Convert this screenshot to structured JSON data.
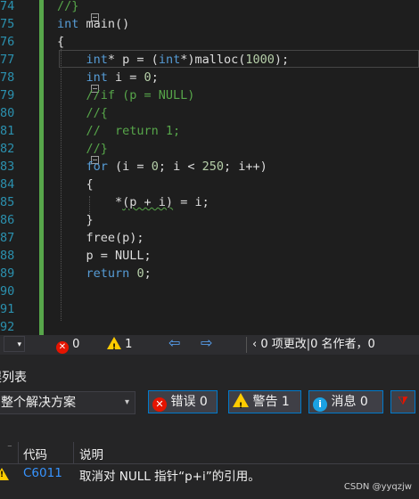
{
  "editor": {
    "line_numbers": [
      "74",
      "75",
      "76",
      "77",
      "78",
      "79",
      "80",
      "81",
      "82",
      "83",
      "84",
      "85",
      "86",
      "87",
      "88",
      "89",
      "90",
      "91",
      "92"
    ],
    "lines": [
      {
        "parts": [
          {
            "t": "//}",
            "c": "cm"
          }
        ]
      },
      {
        "parts": [
          {
            "t": "int",
            "c": "kw"
          },
          {
            "t": " main()",
            "c": ""
          }
        ]
      },
      {
        "parts": [
          {
            "t": "{",
            "c": ""
          }
        ]
      },
      {
        "parts": [
          {
            "t": "    ",
            "c": ""
          },
          {
            "t": "int",
            "c": "kw"
          },
          {
            "t": "* p = (",
            "c": ""
          },
          {
            "t": "int",
            "c": "kw"
          },
          {
            "t": "*)malloc(",
            "c": ""
          },
          {
            "t": "1000",
            "c": "nm"
          },
          {
            "t": ");",
            "c": ""
          }
        ]
      },
      {
        "parts": [
          {
            "t": "    ",
            "c": ""
          },
          {
            "t": "int",
            "c": "kw"
          },
          {
            "t": " i = ",
            "c": ""
          },
          {
            "t": "0",
            "c": "nm"
          },
          {
            "t": ";",
            "c": ""
          }
        ]
      },
      {
        "parts": [
          {
            "t": "    //if (p = NULL)",
            "c": "cm"
          }
        ]
      },
      {
        "parts": [
          {
            "t": "    //{",
            "c": "cm"
          }
        ]
      },
      {
        "parts": [
          {
            "t": "    //  return 1;",
            "c": "cm"
          }
        ]
      },
      {
        "parts": [
          {
            "t": "    //}",
            "c": "cm"
          }
        ]
      },
      {
        "parts": [
          {
            "t": "    ",
            "c": ""
          },
          {
            "t": "for",
            "c": "kw"
          },
          {
            "t": " (i = ",
            "c": ""
          },
          {
            "t": "0",
            "c": "nm"
          },
          {
            "t": "; i < ",
            "c": ""
          },
          {
            "t": "250",
            "c": "nm"
          },
          {
            "t": "; i++)",
            "c": ""
          }
        ]
      },
      {
        "parts": [
          {
            "t": "    {",
            "c": ""
          }
        ]
      },
      {
        "parts": [
          {
            "t": "        *",
            "c": ""
          },
          {
            "t": "(p + i)",
            "c": "squiggle"
          },
          {
            "t": " = i;",
            "c": ""
          }
        ]
      },
      {
        "parts": [
          {
            "t": "    }",
            "c": ""
          }
        ]
      },
      {
        "parts": [
          {
            "t": "    free(p);",
            "c": ""
          }
        ]
      },
      {
        "parts": [
          {
            "t": "    p = NULL;",
            "c": ""
          }
        ]
      },
      {
        "parts": [
          {
            "t": "    ",
            "c": ""
          },
          {
            "t": "return",
            "c": "kw"
          },
          {
            "t": " ",
            "c": ""
          },
          {
            "t": "0",
            "c": "nm"
          },
          {
            "t": ";",
            "c": ""
          }
        ]
      },
      {
        "parts": [
          {
            "t": "",
            "c": ""
          }
        ]
      },
      {
        "parts": [
          {
            "t": "",
            "c": ""
          }
        ]
      },
      {
        "parts": [
          {
            "t": "",
            "c": ""
          }
        ]
      }
    ]
  },
  "statusbar": {
    "errors": "0",
    "warnings": "1",
    "changes_text": "0 项更改|0 名作者，0"
  },
  "error_list": {
    "title": "误列表",
    "scope_select": "整个解决方案",
    "errors_label": "错误 0",
    "warnings_label": "警告 1",
    "messages_label": "消息 0",
    "col_code": "代码",
    "col_desc": "说明",
    "rows": [
      {
        "code": "C6011",
        "desc": "取消对 NULL 指针“p+i”的引用。"
      }
    ]
  },
  "watermark": "CSDN @yyqzjw",
  "colors": {
    "keyword": "#569cd6",
    "comment": "#57a64a",
    "number": "#b5cea8",
    "link": "#3794ff",
    "accent": "#007acc"
  }
}
